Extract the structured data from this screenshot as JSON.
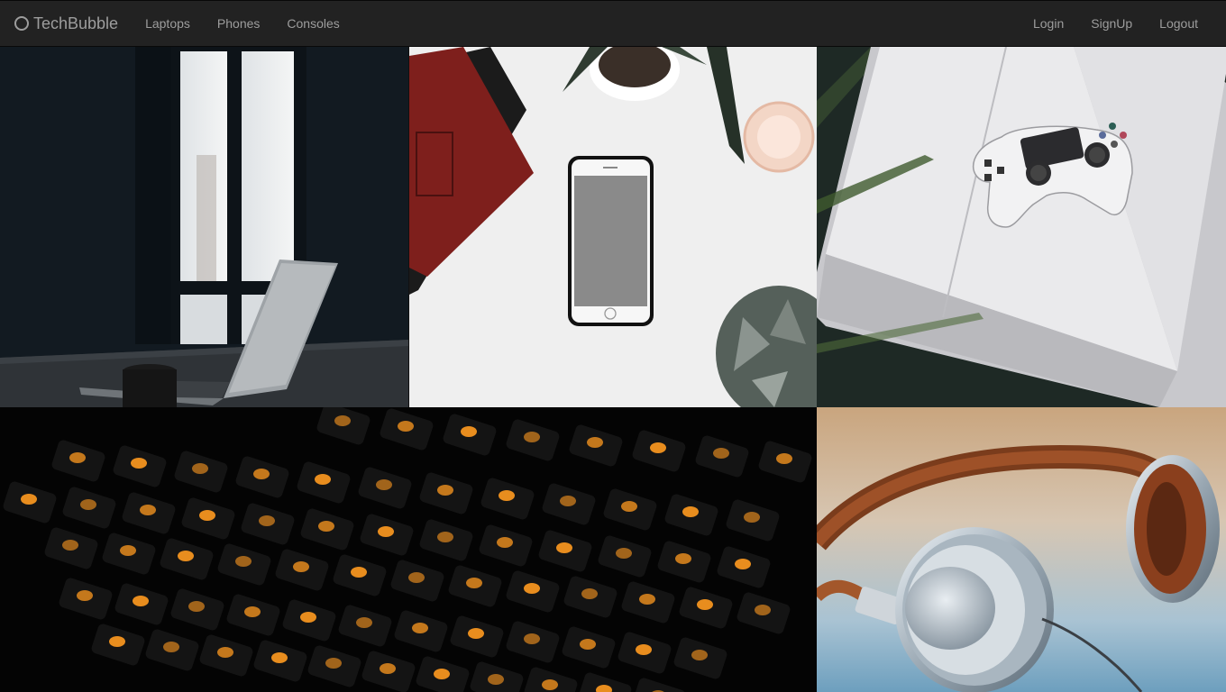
{
  "navbar": {
    "brand": {
      "icon": "circle-logo-icon",
      "label": "TechBubble"
    },
    "left_links": [
      {
        "label": "Laptops"
      },
      {
        "label": "Phones"
      },
      {
        "label": "Consoles"
      }
    ],
    "right_links": [
      {
        "label": "Login"
      },
      {
        "label": "SignUp"
      },
      {
        "label": "Logout"
      }
    ]
  },
  "gallery": {
    "tiles": [
      {
        "subject": "laptop-photo"
      },
      {
        "subject": "phone-photo"
      },
      {
        "subject": "game-console-photo"
      },
      {
        "subject": "keyboard-photo"
      },
      {
        "subject": "headphones-photo"
      }
    ]
  },
  "colors": {
    "navbar_bg": "#222222",
    "nav_text": "#9d9d9d",
    "keyboard_glow": "#ff9a1f"
  }
}
